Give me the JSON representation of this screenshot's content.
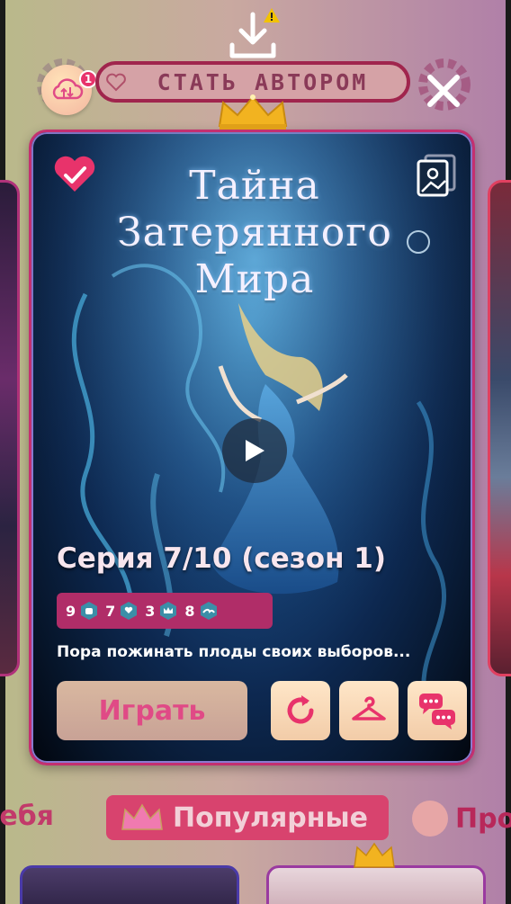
{
  "header": {
    "author_button_label": "СТАТЬ АВТОРОМ",
    "notification_count": "1"
  },
  "story": {
    "cover_title_lines": [
      "Тайна",
      "Затерянного",
      "Мира"
    ],
    "episode": "Серия 7/10 (сезон 1)",
    "stats": [
      {
        "value": "9",
        "icon": "fist-icon"
      },
      {
        "value": "7",
        "icon": "heart-hands-icon"
      },
      {
        "value": "3",
        "icon": "crown-icon"
      },
      {
        "value": "8",
        "icon": "wave-icon"
      }
    ],
    "teaser": "Пора пожинать плоды своих выборов...",
    "play_label": "Играть"
  },
  "tabs": {
    "left_partial": "тебя",
    "active": "Популярные",
    "right_partial": "Про"
  },
  "colors": {
    "accent": "#e04a86",
    "badge": "#e8336b",
    "tab_active": "#d8436e"
  }
}
